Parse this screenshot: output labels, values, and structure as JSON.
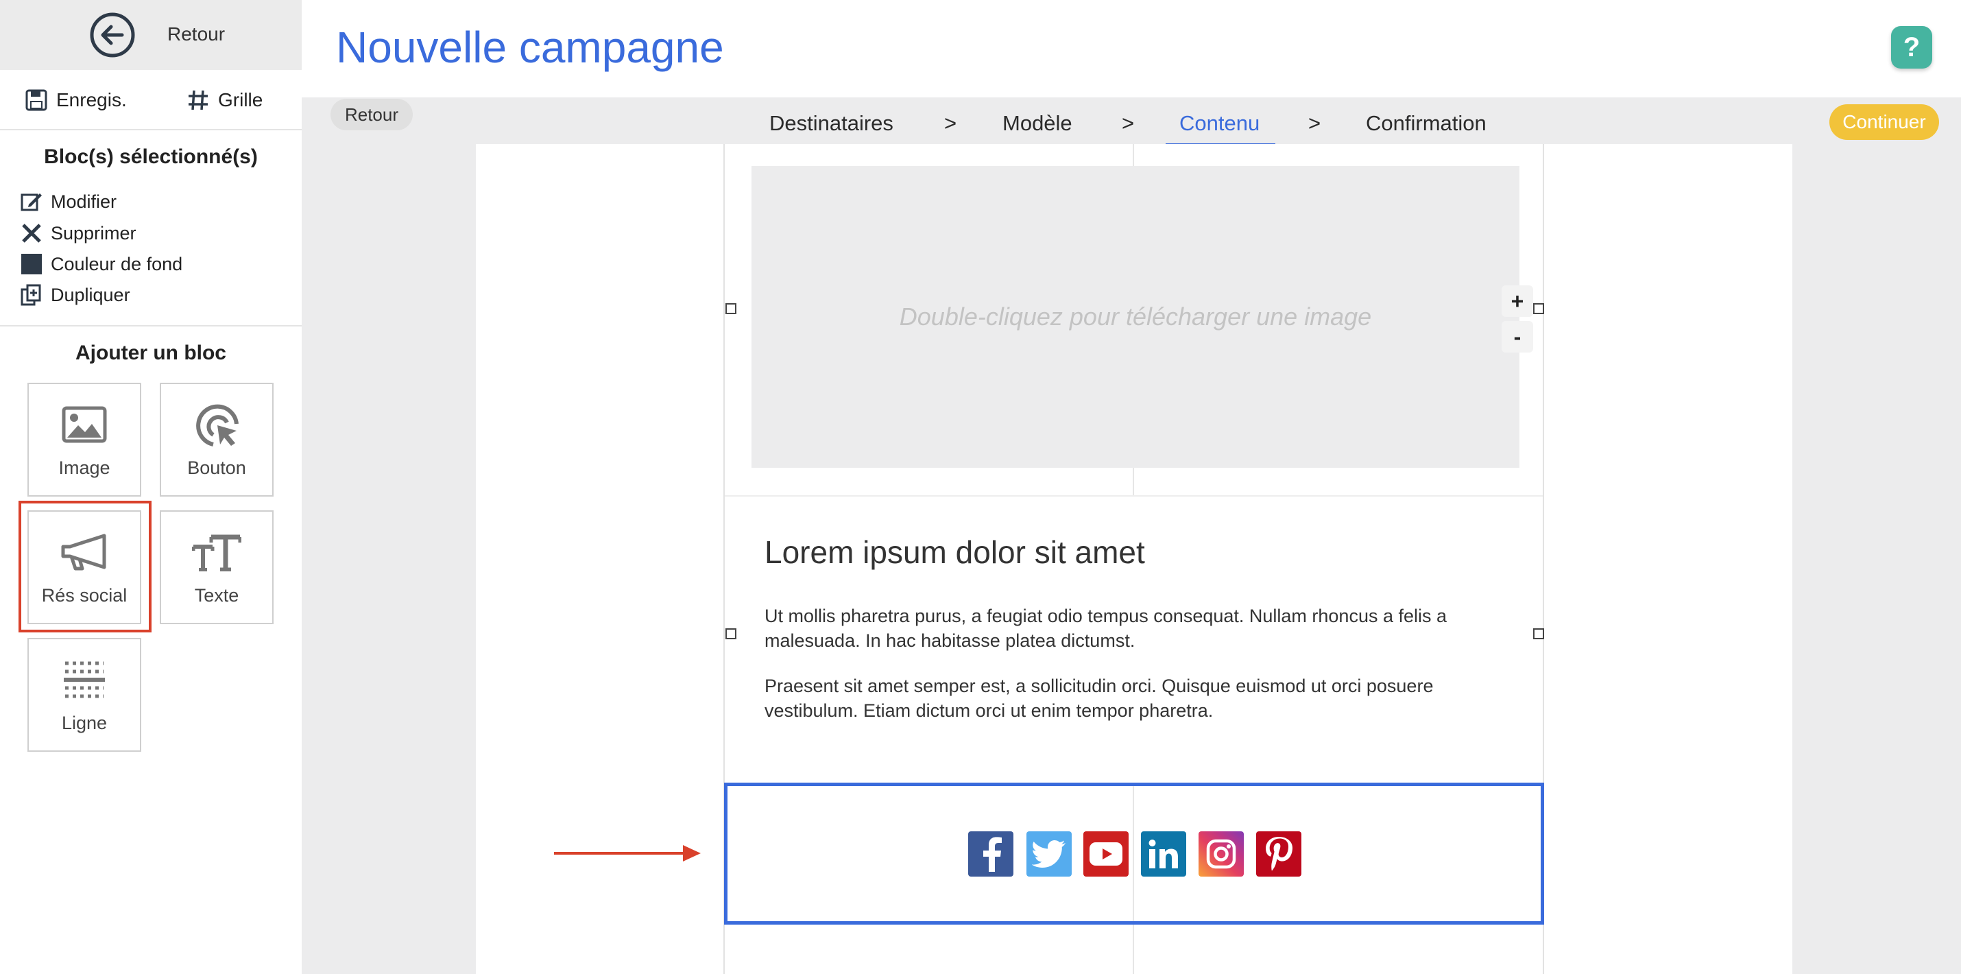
{
  "sidebar": {
    "back_label": "Retour",
    "save_label": "Enregis.",
    "grid_label": "Grille",
    "selected_title": "Bloc(s) sélectionné(s)",
    "actions": {
      "modify": "Modifier",
      "delete": "Supprimer",
      "bg_color": "Couleur de fond",
      "duplicate": "Dupliquer"
    },
    "add_title": "Ajouter un bloc",
    "blocks": {
      "image": "Image",
      "button": "Bouton",
      "social": "Rés social",
      "text": "Texte",
      "line": "Ligne"
    }
  },
  "header": {
    "title": "Nouvelle campagne",
    "help": "?",
    "back_pill": "Retour",
    "continue": "Continuer",
    "steps": [
      "Destinataires",
      "Modèle",
      "Contenu",
      "Confirmation"
    ],
    "step_separator": ">",
    "active_step": "Contenu"
  },
  "email": {
    "image_placeholder": "Double-cliquez pour télécharger une image",
    "zoom_in": "+",
    "zoom_out": "-",
    "heading": "Lorem ipsum dolor sit amet",
    "paragraph1": "Ut mollis pharetra purus, a feugiat odio tempus consequat. Nullam rhoncus a felis a malesuada. In hac habitasse platea dictumst.",
    "paragraph2": "Praesent sit amet semper est, a sollicitudin orci. Quisque euismod ut orci posuere vestibulum. Etiam dictum orci ut enim tempor pharetra.",
    "social_icons": [
      "facebook-icon",
      "twitter-icon",
      "youtube-icon",
      "linkedin-icon",
      "instagram-icon",
      "pinterest-icon"
    ]
  },
  "colors": {
    "accent": "#3a6bdc",
    "continue": "#f2c33a",
    "help": "#46b4a0",
    "highlight": "#d9412b",
    "facebook": "#3b5998",
    "twitter": "#55acee",
    "youtube": "#cd201f",
    "linkedin": "#0e76a8",
    "instagram": "#c13584",
    "pinterest": "#bd081c"
  }
}
